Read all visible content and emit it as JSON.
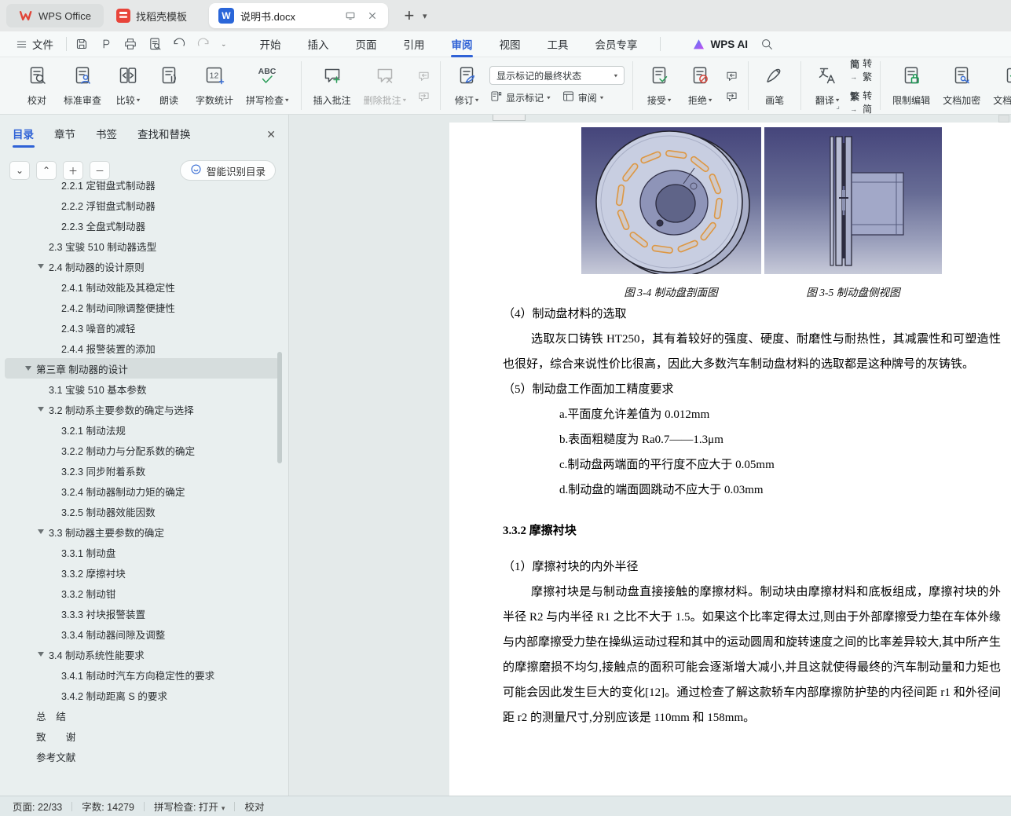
{
  "window_tabs": {
    "app_tab": "WPS Office",
    "docer_tab": "找稻壳模板",
    "doc_tab": "说明书.docx"
  },
  "menu": {
    "file": "文件",
    "items": [
      "开始",
      "插入",
      "页面",
      "引用",
      "审阅",
      "视图",
      "工具",
      "会员专享"
    ],
    "active_item": "审阅",
    "wps_ai": "WPS AI"
  },
  "ribbon": {
    "proofread": "校对",
    "standard_review": "标准审查",
    "compare": "比较",
    "read_aloud": "朗读",
    "word_count": "字数统计",
    "spell_check": "拼写检查",
    "insert_comment": "插入批注",
    "delete_comment": "删除批注",
    "track_changes": "修订",
    "markup_state_value": "显示标记的最终状态",
    "show_markup": "显示标记",
    "review_pane": "审阅",
    "accept": "接受",
    "reject": "拒绝",
    "ink_pen": "画笔",
    "translate": "翻译",
    "tc_prefix": "简",
    "to_traditional": "转繁",
    "ts_prefix": "繁",
    "to_simplified": "转简",
    "restrict_edit": "限制编辑",
    "encrypt": "文档加密",
    "finalize": "文档定稿"
  },
  "icons": {
    "proofread": "doc-magnifier",
    "standard_review": "doc-person",
    "compare": "doc-compare",
    "read_aloud": "doc-sound",
    "word_count": "count-12",
    "spell_check": "abc-check",
    "insert_comment": "comment-plus",
    "delete_comment": "comment-x",
    "comment_prev": "comment-prev",
    "comment_next": "comment-next",
    "track_changes": "doc-pen",
    "show_markup": "doc-markup",
    "review_pane": "review-pane",
    "accept": "doc-check",
    "reject": "doc-reject",
    "ink_pen": "pen",
    "translate": "translate",
    "restrict_edit": "doc-lock",
    "encrypt": "doc-key",
    "finalize": "doc-final",
    "save": "save",
    "export_pdf": "pdf",
    "print": "printer",
    "print_preview": "preview",
    "undo": "undo",
    "redo": "redo",
    "search": "search",
    "smart_toc": "smart-face",
    "hamburger": "hamburger",
    "monitor": "monitor",
    "close": "close-x"
  },
  "sidebar": {
    "tabs": [
      "目录",
      "章节",
      "书签",
      "查找和替换"
    ],
    "active_tab": "目录",
    "smart_toc_button": "智能识别目录",
    "toc_items": [
      {
        "label": "2.2.1 定钳盘式制动器",
        "level": 3
      },
      {
        "label": "2.2.2 浮钳盘式制动器",
        "level": 3
      },
      {
        "label": "2.2.3 全盘式制动器",
        "level": 3
      },
      {
        "label": "2.3 宝骏 510 制动器选型",
        "level": 2
      },
      {
        "label": "2.4 制动器的设计原则",
        "level": 2,
        "expanded": true
      },
      {
        "label": "2.4.1 制动效能及其稳定性",
        "level": 3
      },
      {
        "label": "2.4.2 制动间隙调整便捷性",
        "level": 3
      },
      {
        "label": "2.4.3 噪音的减轻",
        "level": 3
      },
      {
        "label": "2.4.4 报警装置的添加",
        "level": 3
      },
      {
        "label": "第三章 制动器的设计",
        "level": 1,
        "expanded": true,
        "active": true
      },
      {
        "label": "3.1 宝骏 510 基本参数",
        "level": 2
      },
      {
        "label": "3.2 制动系主要参数的确定与选择",
        "level": 2,
        "expanded": true
      },
      {
        "label": "3.2.1 制动法规",
        "level": 3
      },
      {
        "label": "3.2.2 制动力与分配系数的确定",
        "level": 3
      },
      {
        "label": "3.2.3 同步附着系数",
        "level": 3
      },
      {
        "label": "3.2.4 制动器制动力矩的确定",
        "level": 3
      },
      {
        "label": "3.2.5 制动器效能因数",
        "level": 3
      },
      {
        "label": "3.3 制动器主要参数的确定",
        "level": 2,
        "expanded": true
      },
      {
        "label": "3.3.1 制动盘",
        "level": 3
      },
      {
        "label": "3.3.2 摩擦衬块",
        "level": 3
      },
      {
        "label": "3.3.2 制动钳",
        "level": 3
      },
      {
        "label": "3.3.3 衬块报警装置",
        "level": 3
      },
      {
        "label": "3.3.4 制动器间隙及调整",
        "level": 3
      },
      {
        "label": "3.4 制动系统性能要求",
        "level": 2,
        "expanded": true
      },
      {
        "label": "3.4.1 制动时汽车方向稳定性的要求",
        "level": 3
      },
      {
        "label": "3.4.2 制动距离 S 的要求",
        "level": 3
      },
      {
        "label": "总　结",
        "level": 1
      },
      {
        "label": "致　　谢",
        "level": 1
      },
      {
        "label": "参考文献",
        "level": 1
      }
    ]
  },
  "document": {
    "figures": [
      {
        "caption": "图 3-4 制动盘剖面图"
      },
      {
        "caption": "图 3-5 制动盘侧视图"
      }
    ],
    "content": {
      "item4_title": "（4）制动盘材料的选取",
      "item4_body": "选取灰口铸铁 HT250，其有着较好的强度、硬度、耐磨性与耐热性，其减震性和可塑造性也很好，综合来说性价比很高，因此大多数汽车制动盘材料的选取都是这种牌号的灰铸铁。",
      "item5_title": "（5）制动盘工作面加工精度要求",
      "spec_a": "a.平面度允许差值为 0.012mm",
      "spec_b": "b.表面粗糙度为 Ra0.7——1.3μm",
      "spec_c": "c.制动盘两端面的平行度不应大于 0.05mm",
      "spec_d": "d.制动盘的端面圆跳动不应大于 0.03mm",
      "heading_332": "3.3.2 摩擦衬块",
      "sub1_title": "（1）摩擦衬块的内外半径",
      "sub1_body": "摩擦衬块是与制动盘直接接触的摩擦材料。制动块由摩擦材料和底板组成，摩擦衬块的外半径 R2 与内半径 R1 之比不大于 1.5。如果这个比率定得太过,则由于外部摩擦受力垫在车体外缘与内部摩擦受力垫在操纵运动过程和其中的运动圆周和旋转速度之间的比率差异较大,其中所产生的摩擦磨损不均匀,接触点的面积可能会逐渐增大减小,并且这就使得最终的汽车制动量和力矩也可能会因此发生巨大的变化[12]。通过检查了解这款轿车内部摩擦防护垫的内径间距 r1 和外径间距 r2 的测量尺寸,分别应该是 110mm 和 158mm。"
    }
  },
  "statusbar": {
    "page": "页面: 22/33",
    "words": "字数: 14279",
    "spell": "拼写检查: 打开",
    "proofread": "校对"
  },
  "colors": {
    "accent_blue": "#2f62d6",
    "green": "#2e9e5b",
    "red": "#d4483e",
    "cad_top": "#45457b",
    "cad_bottom": "#c7cad9",
    "slot_orange": "#dd9743"
  }
}
